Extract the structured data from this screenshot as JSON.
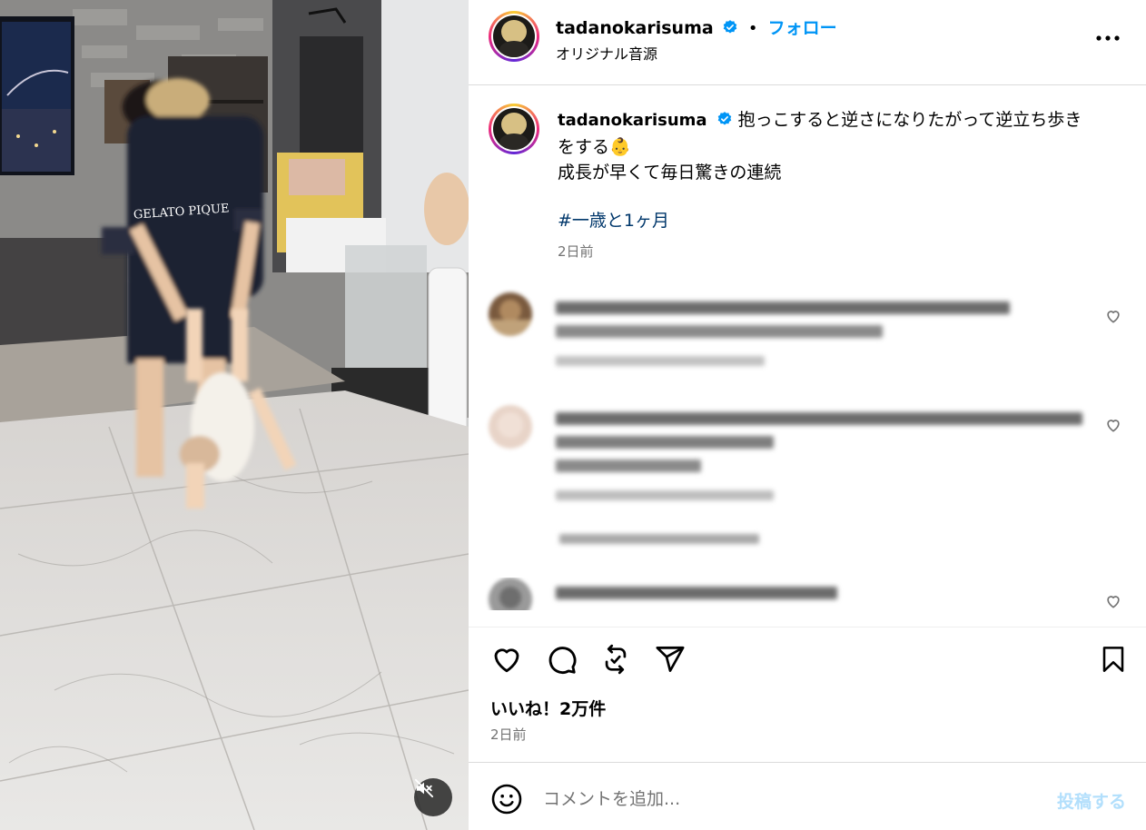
{
  "post": {
    "username": "tadanokarisuma",
    "separator": "•",
    "follow_label": "フォロー",
    "audio_label": "オリジナル音源",
    "caption_line1": "抱っこすると逆さになりたがって逆立ち歩き",
    "caption_line2": "をする",
    "caption_emoji": "👶",
    "caption_line3": "成長が早くて毎日驚きの連続",
    "hashtag": "#一歳と1ヶ月",
    "caption_time": "2日前",
    "likes": "いいね！2万件",
    "time": "2日前",
    "comment_placeholder": "コメントを追加...",
    "post_button": "投稿する"
  },
  "media": {
    "shirt_text": "GELATO PIQUE"
  },
  "icons": {
    "verified": "verified-badge-icon",
    "more": "more-options-icon",
    "like": "heart-icon",
    "comment": "comment-bubble-icon",
    "repost": "repost-icon",
    "share": "send-paper-plane-icon",
    "save": "bookmark-icon",
    "emoji": "emoji-smile-icon",
    "mute": "speaker-muted-icon"
  },
  "colors": {
    "accent": "#0095f6",
    "hashtag": "#00376b",
    "secondary_text": "#737373",
    "post_button_disabled": "#b2dffc",
    "verified": "#0095f6"
  }
}
